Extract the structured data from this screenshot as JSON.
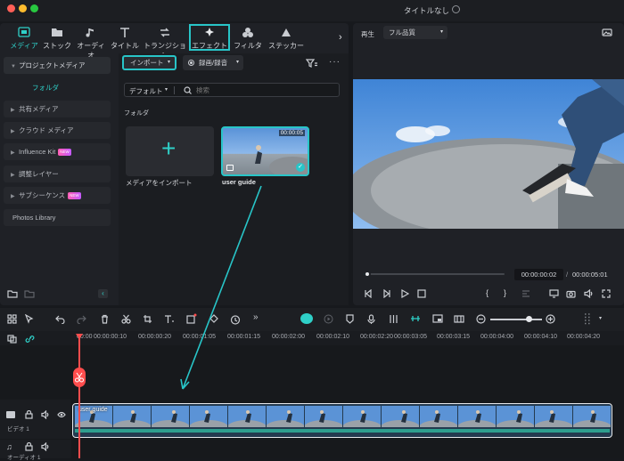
{
  "window": {
    "title": "タイトルなし"
  },
  "tabs": [
    {
      "label": "メディア",
      "icon": "media-icon"
    },
    {
      "label": "ストック",
      "icon": "stock-icon"
    },
    {
      "label": "オーディオ",
      "icon": "music-icon"
    },
    {
      "label": "タイトル",
      "icon": "title-icon"
    },
    {
      "label": "トランジション",
      "icon": "transition-icon"
    },
    {
      "label": "エフェクト",
      "icon": "effect-icon"
    },
    {
      "label": "フィルター",
      "icon": "filter-icon"
    },
    {
      "label": "ステッカー",
      "icon": "sticker-icon"
    }
  ],
  "sidebar": {
    "project_media": "プロジェクトメディア",
    "folder": "フォルダ",
    "items": [
      {
        "label": "共有メディア"
      },
      {
        "label": "クラウド メディア"
      },
      {
        "label": "Influence Kit",
        "badge": "NEW"
      },
      {
        "label": "調整レイヤー"
      },
      {
        "label": "サブシーケンス",
        "badge": "NEW"
      },
      {
        "label": "Photos Library"
      }
    ]
  },
  "media": {
    "import_label": "インポート",
    "record_label": "録画/録音",
    "sort_label": "デフォルト",
    "search_placeholder": "検索",
    "folder_heading": "フォルダ",
    "import_card_label": "メディアをインポート",
    "clip_label": "user guide",
    "clip_duration": "00:00:05"
  },
  "preview": {
    "playback_label": "再生",
    "quality": "フル品質",
    "current_time": "00:00:00:02",
    "separator": "/",
    "total_time": "00:00:05:01",
    "progress": 0.01
  },
  "timeline": {
    "ruler": [
      "00:00",
      "00:00:00:10",
      "00:00:00:20",
      "00:00:01:05",
      "00:00:01:15",
      "00:00:02:00",
      "00:00:02:10",
      "00:00:02:20",
      "00:00:03:05",
      "00:00:03:15",
      "00:00:04:00",
      "00:00:04:10",
      "00:00:04:20"
    ],
    "video_track_label": "ビデオ 1",
    "audio_track_label": "オーディオ 1",
    "clip_name": "user guide"
  },
  "colors": {
    "accent": "#28c5c8",
    "playhead": "#ff4d4d"
  }
}
